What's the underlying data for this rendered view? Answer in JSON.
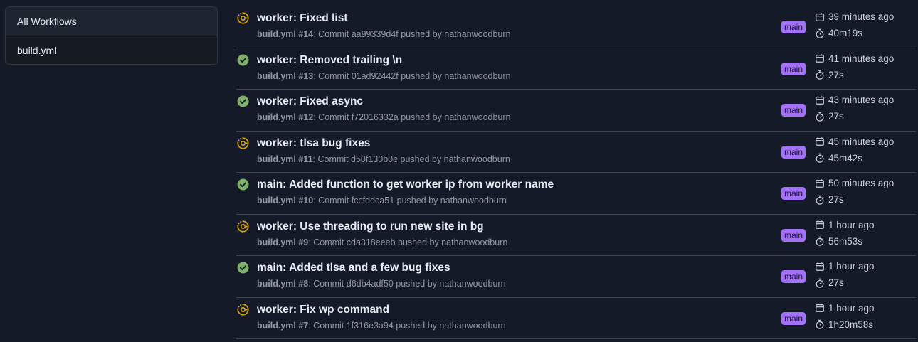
{
  "sidebar": {
    "items": [
      {
        "label": "All Workflows"
      },
      {
        "label": "build.yml"
      }
    ]
  },
  "colors": {
    "success": "#7fb069",
    "in_progress": "#d4a017",
    "branch_bg": "#a371f7"
  },
  "icons": {
    "success": "check-circle-icon",
    "in_progress": "in-progress-icon",
    "date": "calendar-icon",
    "duration": "stopwatch-icon"
  },
  "runs": [
    {
      "status": "in_progress",
      "title": "worker: Fixed list",
      "workflow": "build.yml",
      "run_number": "#14",
      "meta": ": Commit aa99339d4f pushed by nathanwoodburn",
      "branch": "main",
      "time_ago": "39 minutes ago",
      "duration": "40m19s"
    },
    {
      "status": "success",
      "title": "worker: Removed trailing \\n",
      "workflow": "build.yml",
      "run_number": "#13",
      "meta": ": Commit 01ad92442f pushed by nathanwoodburn",
      "branch": "main",
      "time_ago": "41 minutes ago",
      "duration": "27s"
    },
    {
      "status": "success",
      "title": "worker: Fixed async",
      "workflow": "build.yml",
      "run_number": "#12",
      "meta": ": Commit f72016332a pushed by nathanwoodburn",
      "branch": "main",
      "time_ago": "43 minutes ago",
      "duration": "27s"
    },
    {
      "status": "in_progress",
      "title": "worker: tlsa bug fixes",
      "workflow": "build.yml",
      "run_number": "#11",
      "meta": ": Commit d50f130b0e pushed by nathanwoodburn",
      "branch": "main",
      "time_ago": "45 minutes ago",
      "duration": "45m42s"
    },
    {
      "status": "success",
      "title": "main: Added function to get worker ip from worker name",
      "workflow": "build.yml",
      "run_number": "#10",
      "meta": ": Commit fccfddca51 pushed by nathanwoodburn",
      "branch": "main",
      "time_ago": "50 minutes ago",
      "duration": "27s"
    },
    {
      "status": "in_progress",
      "title": "worker: Use threading to run new site in bg",
      "workflow": "build.yml",
      "run_number": "#9",
      "meta": ": Commit cda318eeeb pushed by nathanwoodburn",
      "branch": "main",
      "time_ago": "1 hour ago",
      "duration": "56m53s"
    },
    {
      "status": "success",
      "title": "main: Added tlsa and a few bug fixes",
      "workflow": "build.yml",
      "run_number": "#8",
      "meta": ": Commit d6db4adf50 pushed by nathanwoodburn",
      "branch": "main",
      "time_ago": "1 hour ago",
      "duration": "27s"
    },
    {
      "status": "in_progress",
      "title": "worker: Fix wp command",
      "workflow": "build.yml",
      "run_number": "#7",
      "meta": ": Commit 1f316e3a94 pushed by nathanwoodburn",
      "branch": "main",
      "time_ago": "1 hour ago",
      "duration": "1h20m58s"
    }
  ]
}
